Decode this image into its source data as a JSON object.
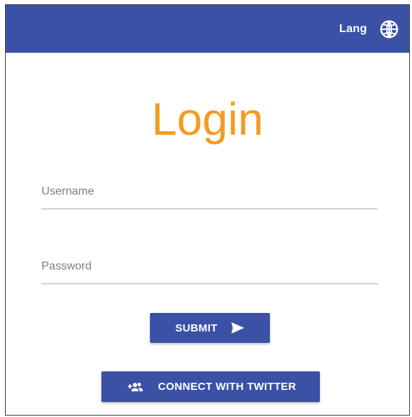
{
  "topbar": {
    "lang_label": "Lang",
    "lang_icon": "globe-icon"
  },
  "login": {
    "title": "Login",
    "username_placeholder": "Username",
    "password_placeholder": "Password",
    "username_value": "",
    "password_value": "",
    "submit_label": "SUBMIT",
    "submit_icon": "send-icon",
    "twitter_label": "CONNECT WITH TWITTER",
    "twitter_icon": "group-add-icon"
  },
  "colors": {
    "primary": "#3a51a6",
    "title": "#f49b22",
    "input_line": "#cfcfcf"
  }
}
